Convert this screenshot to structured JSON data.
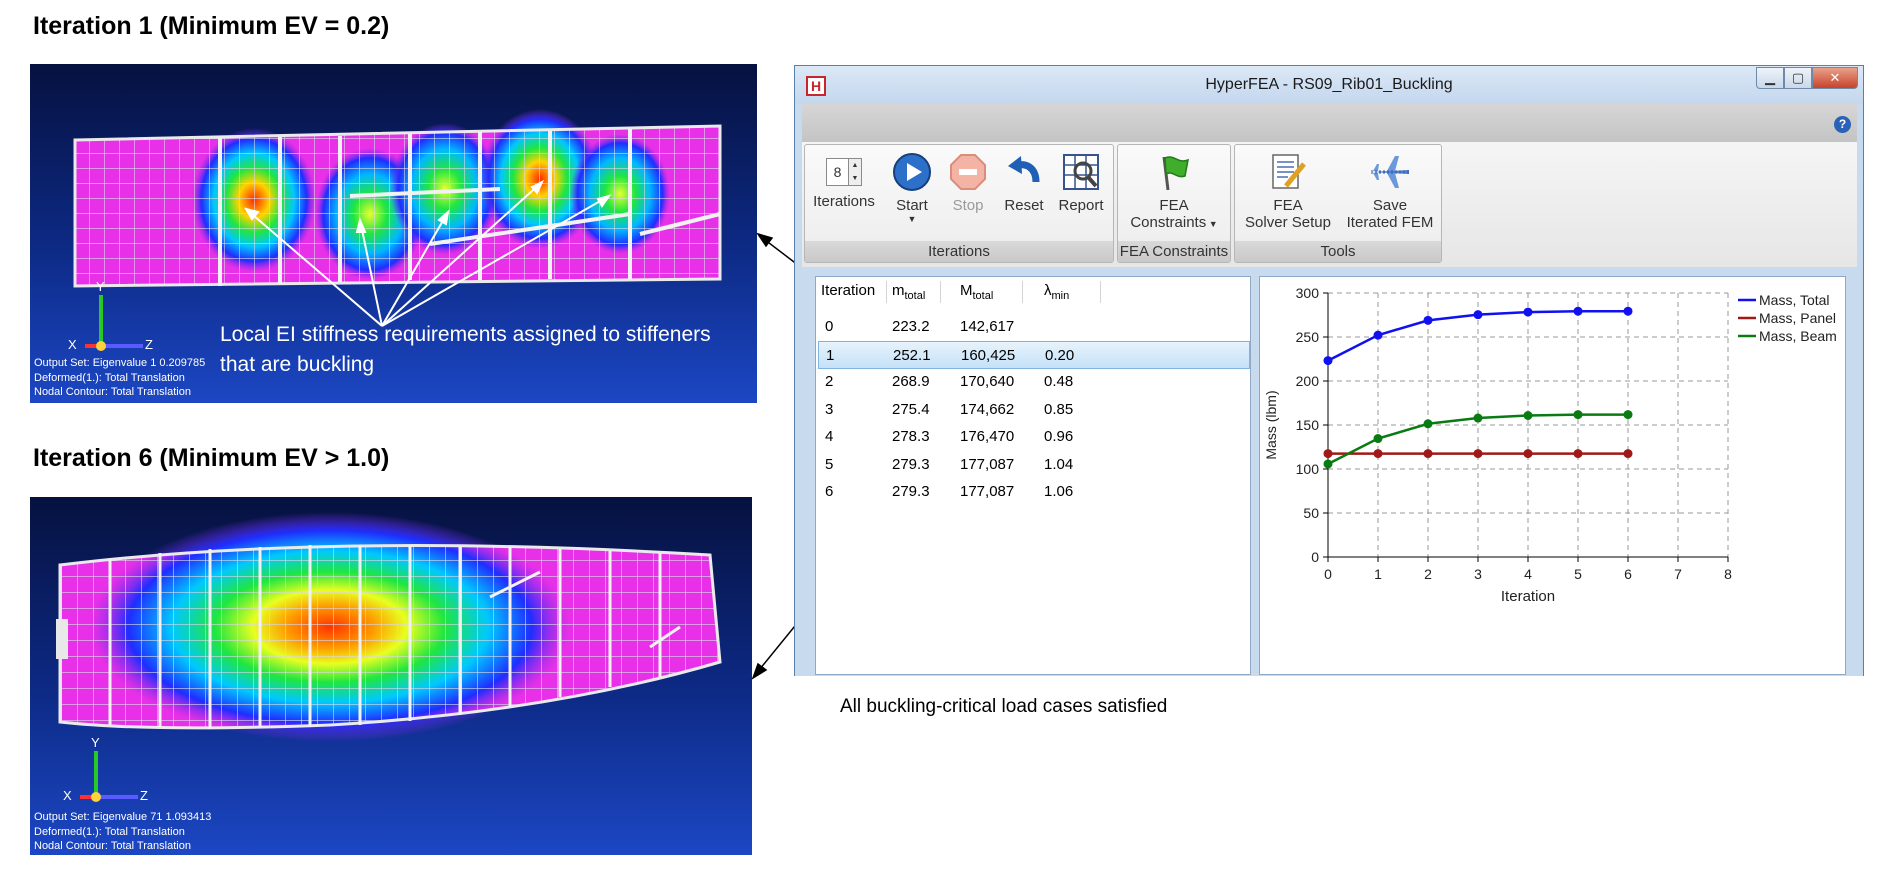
{
  "headings": {
    "iter1": "Iteration 1 (Minimum EV = 0.2)",
    "iter6": "Iteration 6 (Minimum EV > 1.0)"
  },
  "fea_top": {
    "info": [
      "Output Set: Eigenvalue 1 0.209785",
      "Deformed(1.): Total Translation",
      "Nodal Contour: Total Translation"
    ],
    "axes": {
      "x": "X",
      "y": "Y",
      "z": "Z"
    },
    "callout": [
      "Local EI stiffness requirements assigned to stiffeners",
      "that are buckling"
    ]
  },
  "fea_bottom": {
    "info": [
      "Output Set: Eigenvalue 71 1.093413",
      "Deformed(1.): Total Translation",
      "Nodal Contour: Total Translation"
    ],
    "axes": {
      "x": "X",
      "y": "Y",
      "z": "Z"
    }
  },
  "note": "All buckling-critical load cases satisfied",
  "window": {
    "title": "HyperFEA - RS09_Rib01_Buckling",
    "app_icon": "H",
    "buttons": {
      "minimize": "minimize-icon",
      "maximize": "maximize-icon",
      "close": "close-icon"
    },
    "help": "?"
  },
  "ribbon": {
    "iterations_group": "Iterations",
    "iterations_value": "8",
    "iterations_label": "Iterations",
    "start": "Start",
    "stop": "Stop",
    "reset": "Reset",
    "report": "Report",
    "constraints_group": "FEA Constraints",
    "fea_constraints": [
      "FEA",
      "Constraints"
    ],
    "tools_group": "Tools",
    "solver_setup": [
      "FEA",
      "Solver Setup"
    ],
    "save_iterated": [
      "Save",
      "Iterated FEM"
    ]
  },
  "table": {
    "headers": {
      "iteration": "Iteration",
      "m": "m",
      "m_sub": "total",
      "M": "M",
      "M_sub": "total",
      "lambda": "λ",
      "lambda_sub": "min"
    },
    "rows": [
      {
        "iteration": "0",
        "m": "223.2",
        "M": "142,617",
        "lambda": ""
      },
      {
        "iteration": "1",
        "m": "252.1",
        "M": "160,425",
        "lambda": "0.20"
      },
      {
        "iteration": "2",
        "m": "268.9",
        "M": "170,640",
        "lambda": "0.48"
      },
      {
        "iteration": "3",
        "m": "275.4",
        "M": "174,662",
        "lambda": "0.85"
      },
      {
        "iteration": "4",
        "m": "278.3",
        "M": "176,470",
        "lambda": "0.96"
      },
      {
        "iteration": "5",
        "m": "279.3",
        "M": "177,087",
        "lambda": "1.04"
      },
      {
        "iteration": "6",
        "m": "279.3",
        "M": "177,087",
        "lambda": "1.06"
      }
    ],
    "selected_row": 1
  },
  "chart_data": {
    "type": "line",
    "title": "",
    "xlabel": "Iteration",
    "ylabel": "Mass (lbm)",
    "xlim": [
      0,
      8
    ],
    "ylim": [
      0,
      300
    ],
    "xticks": [
      0,
      1,
      2,
      3,
      4,
      5,
      6,
      7,
      8
    ],
    "yticks": [
      0,
      50,
      100,
      150,
      200,
      250,
      300
    ],
    "grid": true,
    "legend_position": "top-right",
    "x": [
      0,
      1,
      2,
      3,
      4,
      5,
      6
    ],
    "series": [
      {
        "name": "Mass, Total",
        "color": "#1010f0",
        "values": [
          223.2,
          252.1,
          268.9,
          275.4,
          278.3,
          279.3,
          279.3
        ]
      },
      {
        "name": "Mass, Panel",
        "color": "#a01818",
        "values": [
          117.5,
          117.5,
          117.5,
          117.5,
          117.5,
          117.5,
          117.5
        ]
      },
      {
        "name": "Mass, Beam",
        "color": "#0a7a12",
        "values": [
          105.7,
          134.6,
          151.4,
          157.9,
          160.8,
          161.8,
          161.8
        ]
      }
    ]
  }
}
